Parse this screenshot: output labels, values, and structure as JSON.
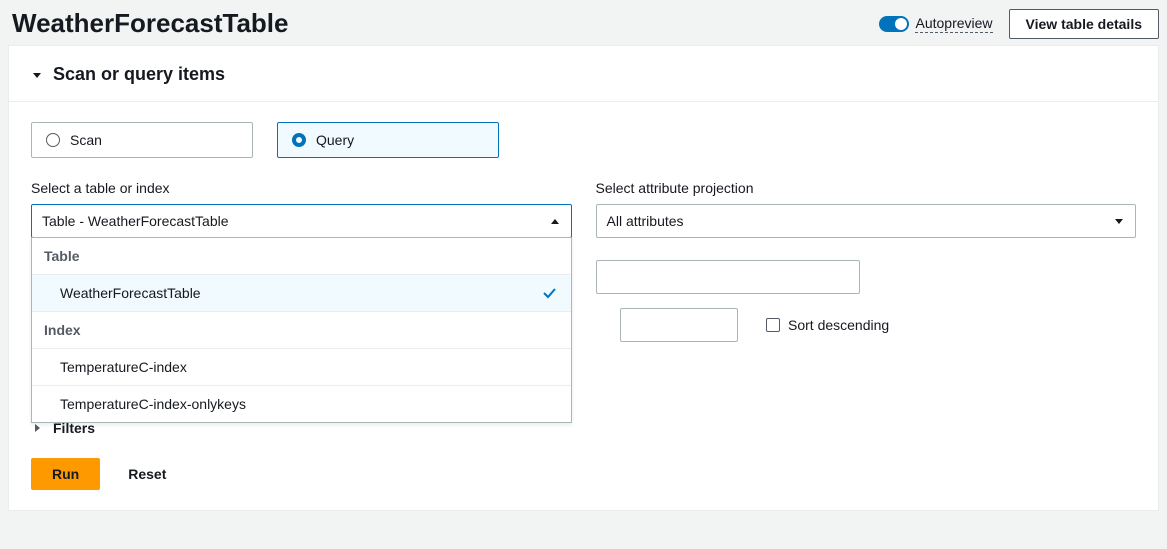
{
  "header": {
    "title": "WeatherForecastTable",
    "autopreview_label": "Autopreview",
    "view_details_label": "View table details"
  },
  "panel": {
    "title": "Scan or query items"
  },
  "mode": {
    "scan_label": "Scan",
    "query_label": "Query",
    "selected": "Query"
  },
  "left_select": {
    "label": "Select a table or index",
    "selected_display": "Table - WeatherForecastTable",
    "groups": [
      {
        "label": "Table",
        "options": [
          {
            "label": "WeatherForecastTable",
            "selected": true
          }
        ]
      },
      {
        "label": "Index",
        "options": [
          {
            "label": "TemperatureC-index",
            "selected": false
          },
          {
            "label": "TemperatureC-index-onlykeys",
            "selected": false
          }
        ]
      }
    ]
  },
  "right_select": {
    "label": "Select attribute projection",
    "selected_display": "All attributes"
  },
  "sort_descending_label": "Sort descending",
  "filters_label": "Filters",
  "run_label": "Run",
  "reset_label": "Reset"
}
